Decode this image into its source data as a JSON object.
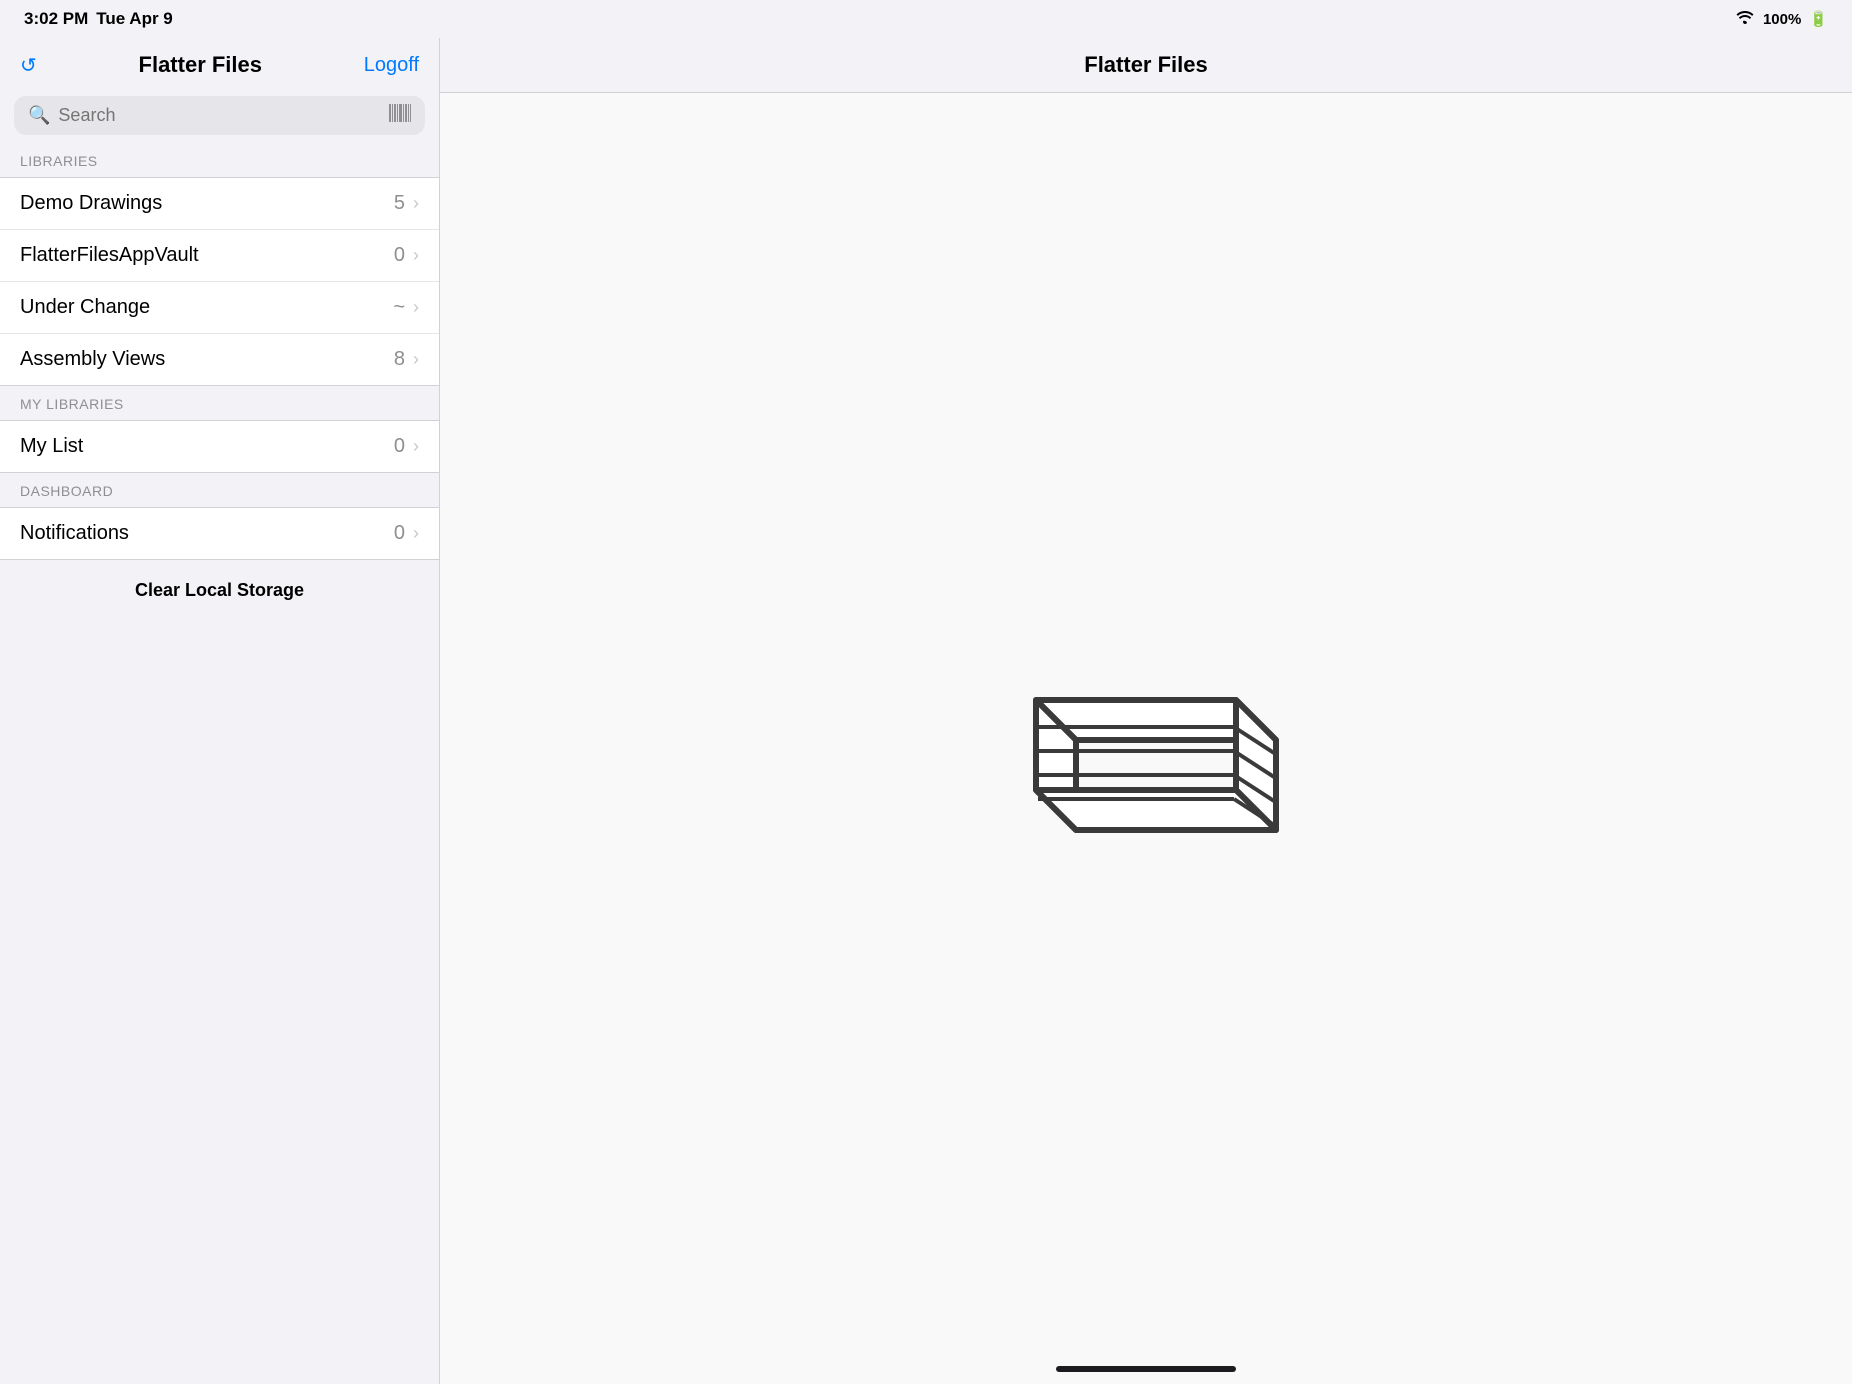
{
  "statusBar": {
    "time": "3:02 PM",
    "date": "Tue Apr 9",
    "wifi": "WiFi",
    "battery": "100%"
  },
  "sidebar": {
    "refreshIcon": "↺",
    "title": "Flatter Files",
    "logoffLabel": "Logoff",
    "search": {
      "placeholder": "Search",
      "barcodeIcon": "barcode"
    },
    "librariesSection": {
      "header": "LIBRARIES",
      "items": [
        {
          "label": "Demo Drawings",
          "count": "5"
        },
        {
          "label": "FlatterFilesAppVault",
          "count": "0"
        },
        {
          "label": "Under Change",
          "count": "~"
        },
        {
          "label": "Assembly Views",
          "count": "8"
        }
      ]
    },
    "myLibrariesSection": {
      "header": "MY LIBRARIES",
      "items": [
        {
          "label": "My List",
          "count": "0"
        }
      ]
    },
    "dashboardSection": {
      "header": "DASHBOARD",
      "items": [
        {
          "label": "Notifications",
          "count": "0"
        }
      ]
    },
    "clearStorageLabel": "Clear Local Storage"
  },
  "mainContent": {
    "title": "Flatter Files"
  },
  "homeIndicator": {
    "visible": true
  }
}
